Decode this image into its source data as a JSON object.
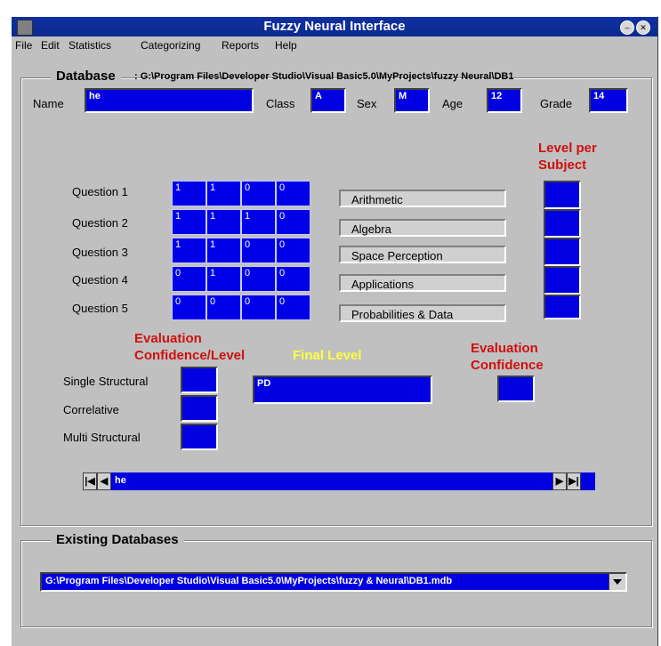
{
  "window": {
    "title": "Fuzzy Neural Interface"
  },
  "menu": [
    "File",
    "Edit",
    "Statistics",
    "Categorizing",
    "Reports",
    "Help"
  ],
  "database": {
    "legend": "Database",
    "path": ": G:\\Program Files\\Developer Studio\\Visual Basic5.0\\MyProjects\\fuzzy  Neural\\DB1",
    "name_label": "Name",
    "name_value": "he",
    "class_label": "Class",
    "class_value": "A",
    "sex_label": "Sex",
    "sex_value": "M",
    "age_label": "Age",
    "age_value": "12",
    "grade_label": "Grade",
    "grade_value": "14"
  },
  "level_per_subject_label": "Level per Subject",
  "questions": [
    {
      "label": "Question 1",
      "values": [
        "1",
        "1",
        "0",
        "0"
      ]
    },
    {
      "label": "Question 2",
      "values": [
        "1",
        "1",
        "1",
        "0"
      ]
    },
    {
      "label": "Question 3",
      "values": [
        "1",
        "1",
        "0",
        "0"
      ]
    },
    {
      "label": "Question 4",
      "values": [
        "0",
        "1",
        "0",
        "0"
      ]
    },
    {
      "label": "Question 5",
      "values": [
        "0",
        "0",
        "0",
        "0"
      ]
    }
  ],
  "subjects": [
    "Arithmetic",
    "Algebra",
    "Space Perception",
    "Applications",
    "Probabilities & Data"
  ],
  "evaluation": {
    "confidence_level_label": "Evaluation Confidence/Level",
    "final_level_label": "Final Level",
    "final_level_value": "PD",
    "evaluation_confidence_label": "Evaluation Confidence",
    "rows": [
      "Single Structural",
      "Correlative",
      "Multi Structural"
    ]
  },
  "navigator": {
    "value": "he",
    "first": "|◀",
    "prev": "◀",
    "next": "▶",
    "last": "▶|"
  },
  "existing": {
    "legend": "Existing Databases",
    "selected": "G:\\Program Files\\Developer Studio\\Visual Basic5.0\\MyProjects\\fuzzy & Neural\\DB1.mdb"
  }
}
